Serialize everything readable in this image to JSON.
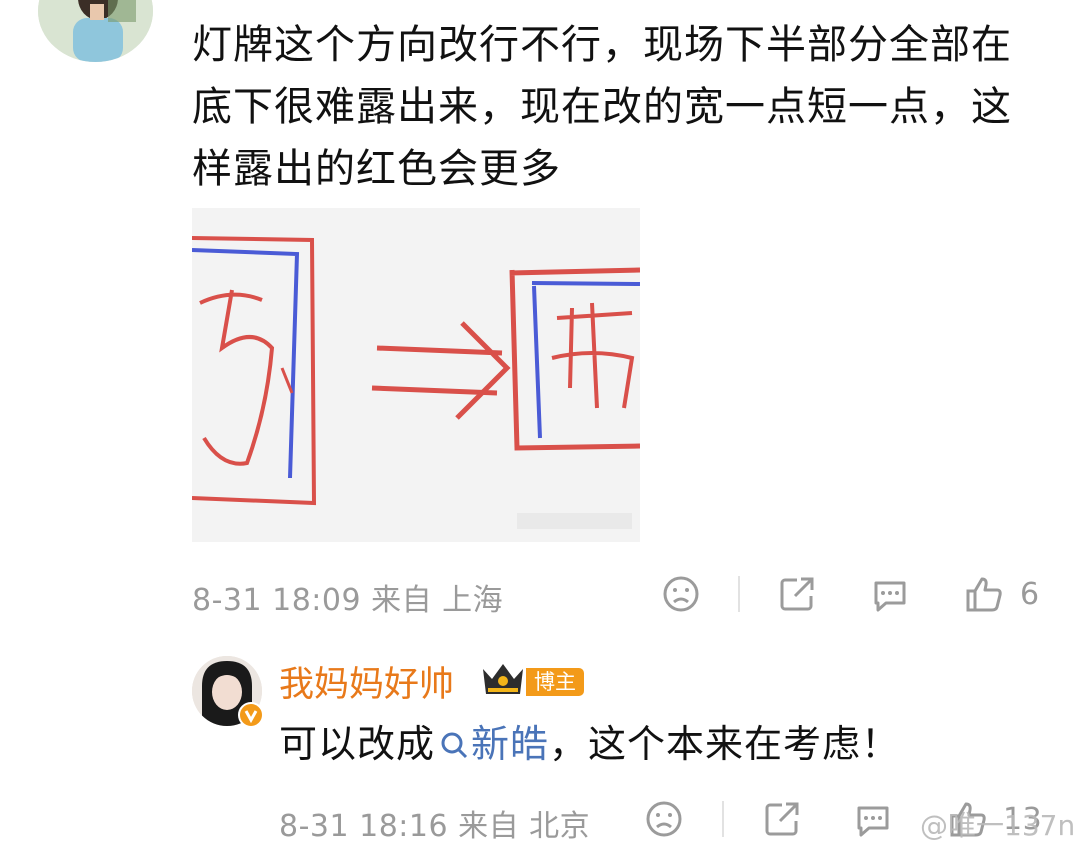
{
  "comment1": {
    "text": "灯牌这个方向改行不行，现场下半部分全部在底下很难露出来，现在改的宽一点短一点，这样露出的红色会更多",
    "meta": "8-31 18:09 来自 上海",
    "likes": "6"
  },
  "comment2": {
    "username": "我妈妈好帅",
    "badge": "博主",
    "text_before": "可以改成",
    "topic": "新皓",
    "text_after": "，这个本来在考虑！",
    "meta": "8-31 18:16 来自 北京",
    "likes": "13"
  },
  "watermark": "@唯一137n",
  "colors": {
    "username": "#e8791a",
    "badge_bg": "#f39a19",
    "topic": "#4a74b8",
    "meta": "#9a9a9a",
    "sketch_red": "#d9504a",
    "sketch_blue": "#4a5bd6"
  },
  "icons": [
    "dislike-icon",
    "share-icon",
    "comment-icon",
    "like-icon",
    "search-icon",
    "crown-icon",
    "verified-icon"
  ]
}
